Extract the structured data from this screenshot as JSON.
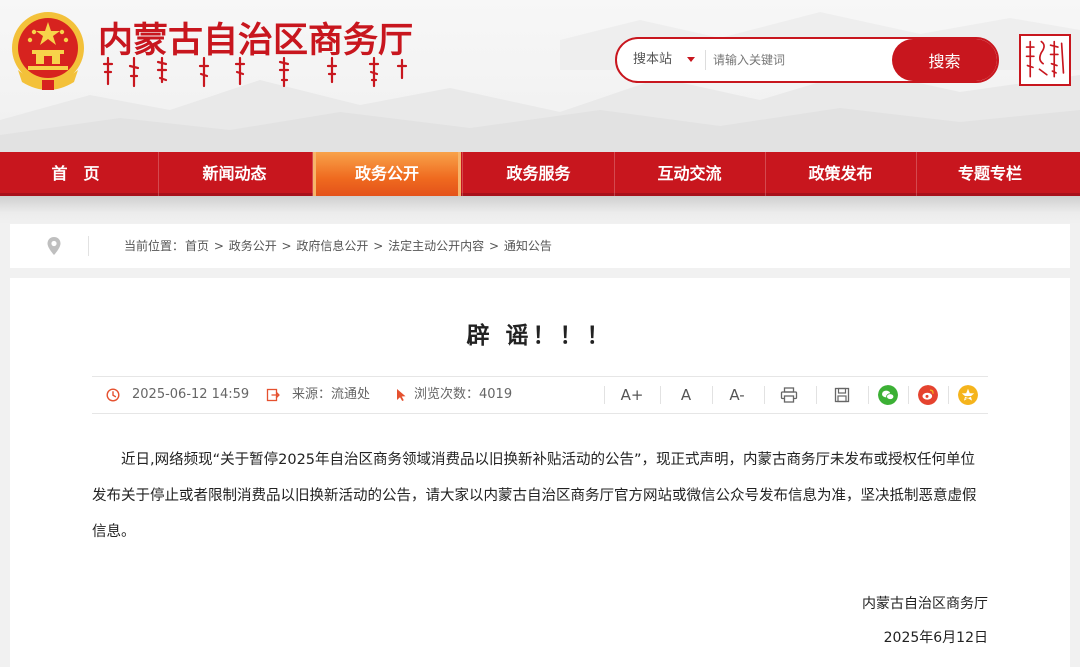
{
  "header": {
    "site_title": "内蒙古自治区商务厅",
    "search": {
      "scope": "搜本站",
      "placeholder": "请输入关键词",
      "button_label": "搜索"
    }
  },
  "nav": {
    "items": [
      {
        "label": "首　页"
      },
      {
        "label": "新闻动态"
      },
      {
        "label": "政务公开"
      },
      {
        "label": "政务服务"
      },
      {
        "label": "互动交流"
      },
      {
        "label": "政策发布"
      },
      {
        "label": "专题专栏"
      }
    ],
    "active_index": 2
  },
  "breadcrumb": {
    "prefix": "当前位置：",
    "items": [
      "首页",
      "政务公开",
      "政府信息公开",
      "法定主动公开内容",
      "通知公告"
    ],
    "separator": " > "
  },
  "article": {
    "title": "辟 谣！！！",
    "meta": {
      "date": "2025-06-12 14:59",
      "source": "来源：流通处",
      "views": "浏览次数：4019"
    },
    "tools": {
      "font_larger": "A+",
      "font_normal": "A",
      "font_smaller": "A-"
    },
    "body": "近日,网络频现“关于暂停2025年自治区商务领域消费品以旧换新补贴活动的公告”，现正式声明，内蒙古商务厅未发布或授权任何单位发布关于停止或者限制消费品以旧换新活动的公告，请大家以内蒙古自治区商务厅官方网站或微信公众号发布信息为准，坚决抵制恶意虚假信息。",
    "signature_org": "内蒙古自治区商务厅",
    "signature_date": "2025年6月12日"
  },
  "colors": {
    "brand_red": "#c8161e",
    "nav_active_orange": "#ef6a1f",
    "wechat_green": "#3cb035",
    "weibo_red": "#e5432f",
    "qzone_yellow": "#f5b41c"
  },
  "icons": {
    "clock": "clock-icon",
    "source": "source-icon",
    "cursor": "cursor-icon",
    "print": "print-icon",
    "save": "save-icon",
    "wechat": "wechat-icon",
    "weibo": "weibo-icon",
    "qzone": "qzone-icon",
    "location": "location-pin-icon"
  }
}
